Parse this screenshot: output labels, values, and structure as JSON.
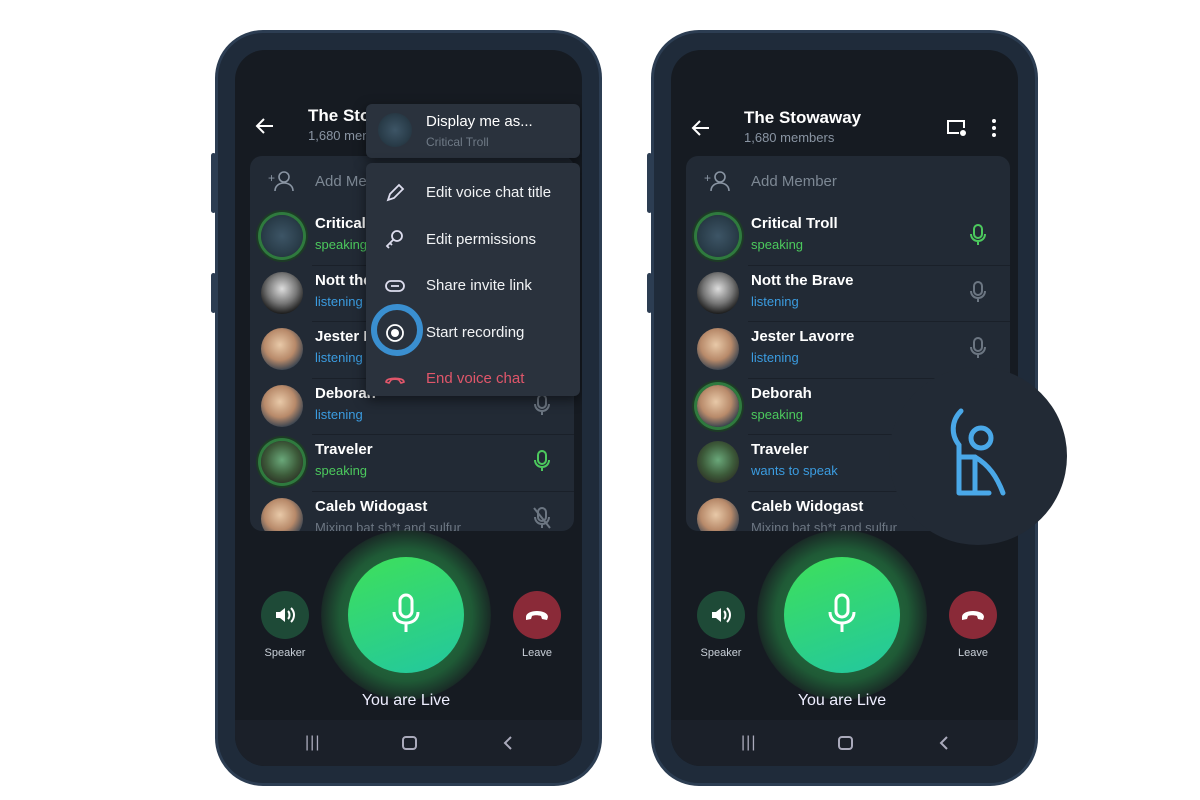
{
  "phones": [
    {
      "header": {
        "title": "The Sto",
        "subtitle": "1,680 mem"
      },
      "add_member": "Add Mem",
      "participants": [
        {
          "name": "Critical",
          "status": "speaking",
          "status_type": "speaking",
          "avatar": "troll",
          "ring": true,
          "mic": "none"
        },
        {
          "name": "Nott the",
          "status": "listening",
          "status_type": "listening",
          "avatar": "bw",
          "ring": false,
          "mic": "none"
        },
        {
          "name": "Jester L",
          "status": "listening",
          "status_type": "listening",
          "avatar": "face",
          "ring": false,
          "mic": "none"
        },
        {
          "name": "Deborah",
          "status": "listening",
          "status_type": "listening",
          "avatar": "face",
          "ring": false,
          "mic": "muted-gray"
        },
        {
          "name": "Traveler",
          "status": "speaking",
          "status_type": "speaking",
          "avatar": "green",
          "ring": true,
          "mic": "active"
        },
        {
          "name": "Caleb Widogast",
          "status": "Mixing bat sh*t and sulfur",
          "status_type": "muted",
          "avatar": "face",
          "ring": false,
          "mic": "off"
        }
      ],
      "menu": {
        "display_as": {
          "title": "Display me as...",
          "subtitle": "Critical Troll"
        },
        "items": [
          {
            "label": "Edit voice chat title",
            "icon": "pencil-icon"
          },
          {
            "label": "Edit permissions",
            "icon": "key-icon"
          },
          {
            "label": "Share invite link",
            "icon": "link-icon"
          },
          {
            "label": "Start recording",
            "icon": "record-icon",
            "highlighted": true
          },
          {
            "label": "End voice chat",
            "icon": "hangup-icon",
            "danger": true
          }
        ]
      },
      "controls": {
        "speaker": "Speaker",
        "leave": "Leave",
        "status": "You are Live"
      }
    },
    {
      "header": {
        "title": "The Stowaway",
        "subtitle": "1,680 members"
      },
      "add_member": "Add Member",
      "participants": [
        {
          "name": "Critical Troll",
          "status": "speaking",
          "status_type": "speaking",
          "avatar": "troll",
          "ring": true,
          "mic": "active"
        },
        {
          "name": "Nott the Brave",
          "status": "listening",
          "status_type": "listening",
          "avatar": "bw",
          "ring": false,
          "mic": "muted-gray"
        },
        {
          "name": "Jester Lavorre",
          "status": "listening",
          "status_type": "listening",
          "avatar": "face",
          "ring": false,
          "mic": "muted-gray"
        },
        {
          "name": "Deborah",
          "status": "speaking",
          "status_type": "speaking",
          "avatar": "face",
          "ring": true,
          "mic": "none"
        },
        {
          "name": "Traveler",
          "status": "wants to speak",
          "status_type": "listening",
          "avatar": "green",
          "ring": false,
          "mic": "none"
        },
        {
          "name": "Caleb Widogast",
          "status": "Mixing bat sh*t and sulfur",
          "status_type": "muted",
          "avatar": "face",
          "ring": false,
          "mic": "none"
        }
      ],
      "raise_hand_icon": "raise-hand-icon",
      "controls": {
        "speaker": "Speaker",
        "leave": "Leave",
        "status": "You are Live"
      }
    }
  ],
  "colors": {
    "speaking": "#4cc95d",
    "listening": "#3b9ce0",
    "muted": "#6c7682",
    "danger": "#e0566a",
    "accent": "#3a8fd0"
  }
}
